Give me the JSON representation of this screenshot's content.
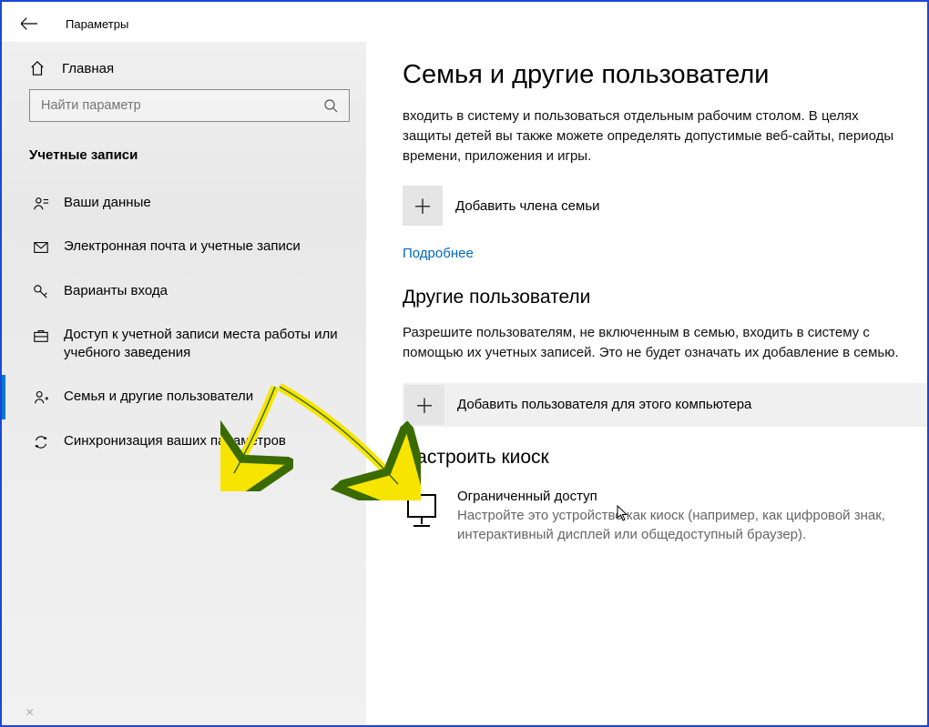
{
  "app_title": "Параметры",
  "home_label": "Главная",
  "search_placeholder": "Найти параметр",
  "section_title": "Учетные записи",
  "nav": [
    {
      "id": "your-info",
      "label": "Ваши данные"
    },
    {
      "id": "email",
      "label": "Электронная почта и учетные записи"
    },
    {
      "id": "signin",
      "label": "Варианты входа"
    },
    {
      "id": "workplace",
      "label": "Доступ к учетной записи места работы или учебного заведения"
    },
    {
      "id": "family",
      "label": "Семья и другие пользователи"
    },
    {
      "id": "sync",
      "label": "Синхронизация ваших параметров"
    }
  ],
  "content": {
    "title": "Семья и другие пользователи",
    "family_description": "входить в систему и пользоваться отдельным рабочим столом. В целях защиты детей вы также можете определять допустимые веб-сайты, периоды времени, приложения и игры.",
    "add_family_label": "Добавить члена семьи",
    "more_link": "Подробнее",
    "other_heading": "Другие пользователи",
    "other_description": "Разрешите пользователям, не включенным в семью, входить в систему с помощью их учетных записей. Это не будет означать их добавление в семью.",
    "add_other_label": "Добавить пользователя для этого компьютера",
    "kiosk_heading": "Настроить киоск",
    "kiosk_title": "Ограниченный доступ",
    "kiosk_description": "Настройте это устройство как киоск (например, как цифровой знак, интерактивный дисплей или общедоступный браузер)."
  }
}
